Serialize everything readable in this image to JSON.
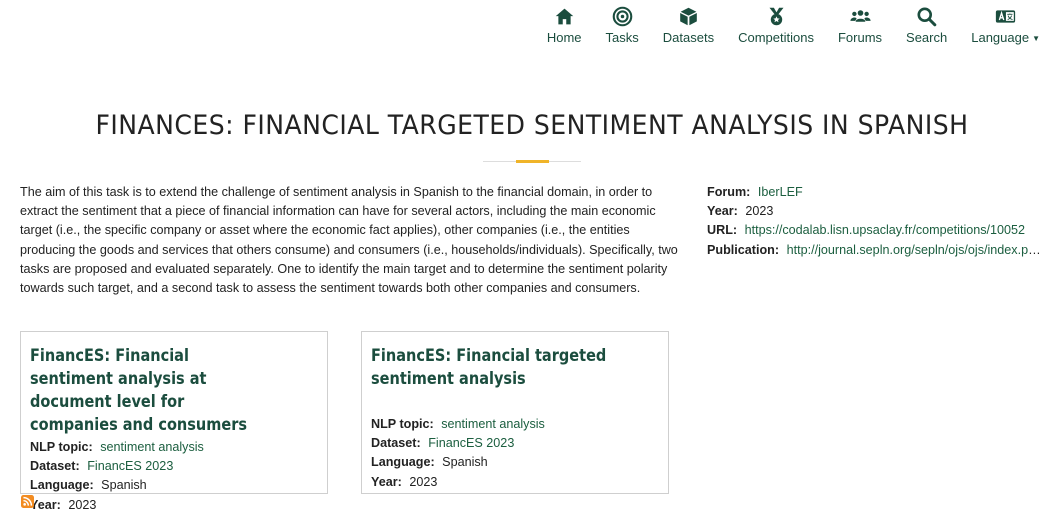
{
  "nav": {
    "items": [
      {
        "label": "Home",
        "icon": "home-icon"
      },
      {
        "label": "Tasks",
        "icon": "target-icon"
      },
      {
        "label": "Datasets",
        "icon": "cube-icon"
      },
      {
        "label": "Competitions",
        "icon": "medal-icon"
      },
      {
        "label": "Forums",
        "icon": "users-icon"
      },
      {
        "label": "Search",
        "icon": "search-icon"
      },
      {
        "label": "Language",
        "icon": "language-icon"
      }
    ]
  },
  "page": {
    "title": "FINANCES: FINANCIAL TARGETED SENTIMENT ANALYSIS IN SPANISH",
    "description": "The aim of this task is to extend the challenge of sentiment analysis in Spanish to the financial domain, in order to extract the sentiment that a piece of financial information can have for several actors, including the main economic target (i.e., the specific company or asset where the economic fact applies), other companies (i.e., the entities producing the goods and services that others consume) and consumers (i.e., households/individuals). Specifically, two tasks are proposed and evaluated separately. One to identify the main target and to determine the sentiment polarity towards such target, and a second task to assess the sentiment towards both other companies and consumers."
  },
  "meta": {
    "forum_label": "Forum:",
    "forum_value": "IberLEF",
    "year_label": "Year:",
    "year_value": "2023",
    "url_label": "URL:",
    "url_value": "https://codalab.lisn.upsaclay.fr/competitions/10052",
    "publication_label": "Publication:",
    "publication_value": "http://journal.sepln.org/sepln/ojs/ojs/index.php/pln"
  },
  "cards": [
    {
      "title": "FinancES: Financial sentiment analysis at document level for companies and consumers",
      "nlp_topic_label": "NLP topic:",
      "nlp_topic": "sentiment analysis",
      "dataset_label": "Dataset:",
      "dataset": "FinancES 2023",
      "language_label": "Language:",
      "language": "Spanish",
      "year_label": "Year:",
      "year": "2023"
    },
    {
      "title": "FinancES: Financial targeted sentiment analysis",
      "nlp_topic_label": "NLP topic:",
      "nlp_topic": "sentiment analysis",
      "dataset_label": "Dataset:",
      "dataset": "FinancES 2023",
      "language_label": "Language:",
      "language": "Spanish",
      "year_label": "Year:",
      "year": "2023"
    }
  ],
  "colors": {
    "brand_green": "#1b4d3e",
    "link_green": "#1b5e3f",
    "accent_gold": "#f0b429",
    "rss_orange": "#f28c22"
  },
  "rss_icon": "rss-icon"
}
